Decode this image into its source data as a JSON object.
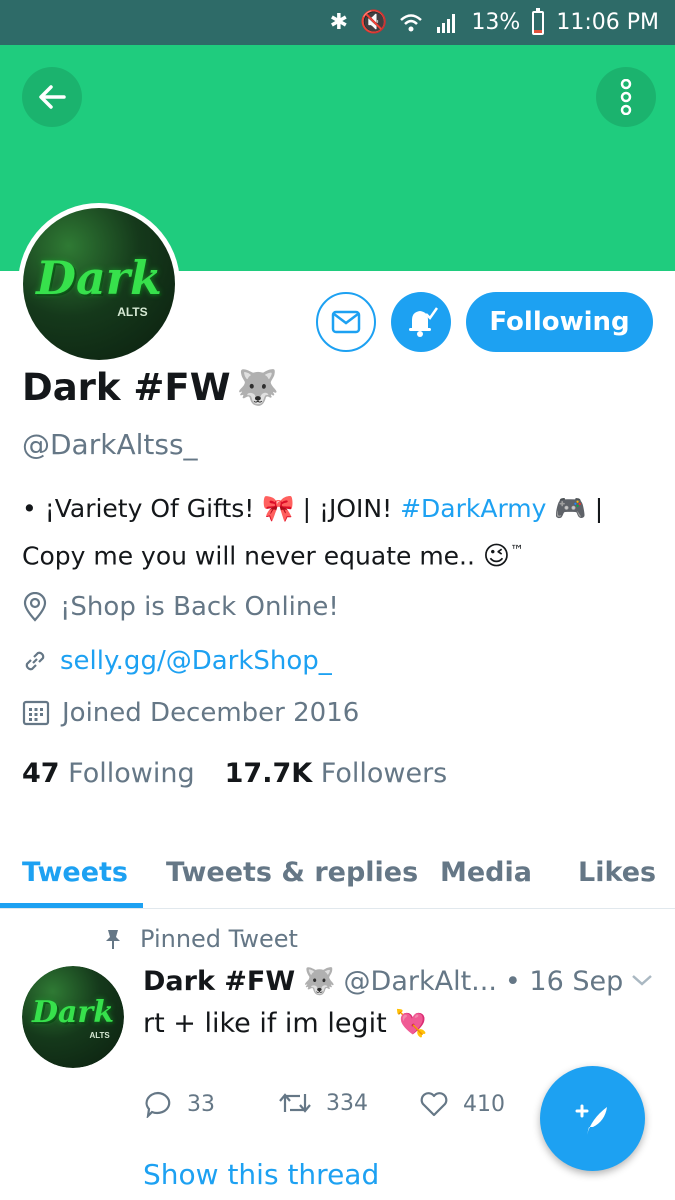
{
  "status_bar": {
    "battery": "13%",
    "time": "11:06 PM",
    "battery_level": 0.13
  },
  "profile": {
    "display_name": "Dark #FW",
    "name_emoji": "🐺",
    "handle": "@DarkAltss_",
    "avatar_text": "Dark",
    "avatar_subtext": "ALTS",
    "bio": {
      "part1": "• ¡Variety Of Gifts! ",
      "emoji_ribbon": "🎀",
      "part2": " | ¡JOIN! ",
      "hashtag": "#DarkArmy",
      "emoji_controller": "🎮",
      "part3": " | Copy me you will never equate me.. ",
      "emoji_wink": "😉",
      "tm": "™"
    },
    "location": "¡Shop is Back Online!",
    "url": "selly.gg/@DarkShop_",
    "joined": "Joined December 2016",
    "following_count": "47",
    "following_label": "Following",
    "followers_count": "17.7K",
    "followers_label": "Followers"
  },
  "buttons": {
    "following": "Following"
  },
  "tabs": [
    {
      "label": "Tweets",
      "active": true
    },
    {
      "label": "Tweets & replies",
      "active": false
    },
    {
      "label": "Media",
      "active": false
    },
    {
      "label": "Likes",
      "active": false
    }
  ],
  "tweet": {
    "pinned_label": "Pinned Tweet",
    "name": "Dark #FW",
    "name_emoji": "🐺",
    "handle": "@DarkAlt...",
    "date": "• 16 Sep",
    "text": "rt + like if im legit ",
    "text_emoji": "💘",
    "reply_count": "33",
    "retweet_count": "334",
    "like_count": "410",
    "show_thread": "Show this thread"
  },
  "colors": {
    "banner": "#1fcc7e",
    "accent": "#1da1f2",
    "statusbar": "#2e6b68",
    "secondary_text": "#657786"
  },
  "icons": [
    "back-arrow-icon",
    "more-vertical-icon",
    "mail-icon",
    "bell-icon",
    "location-pin-icon",
    "link-icon",
    "calendar-icon",
    "pin-icon",
    "chevron-down-icon",
    "reply-icon",
    "retweet-icon",
    "heart-icon",
    "compose-icon"
  ]
}
